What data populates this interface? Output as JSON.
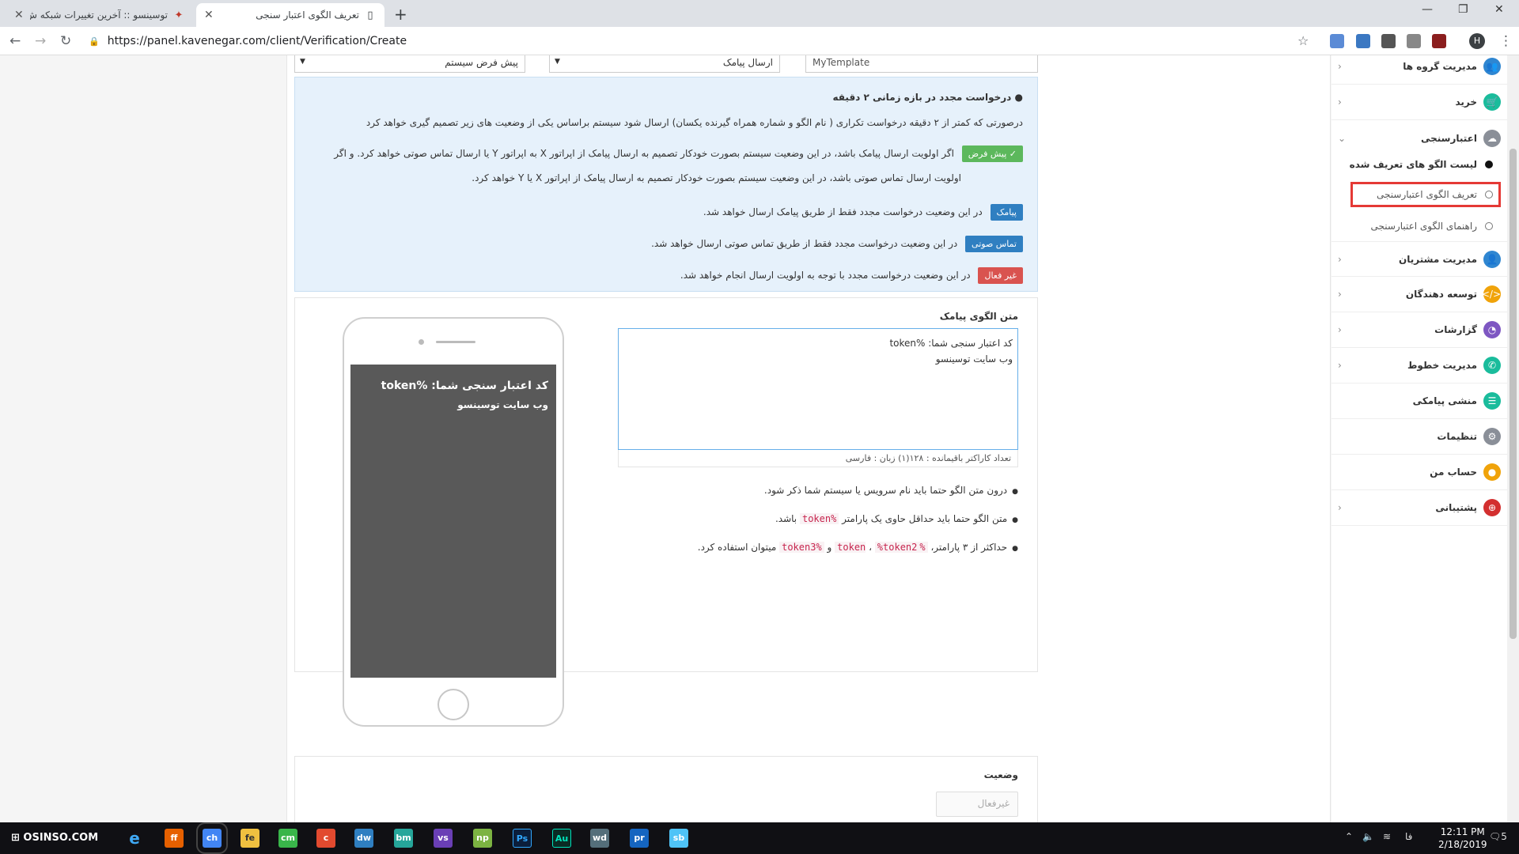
{
  "browser": {
    "tabs": [
      {
        "title": "توسینسو :: آخرین تغییرات شبکه ش..."
      },
      {
        "title": "تعریف الگوی اعتبار سنجی"
      }
    ],
    "url": "https://panel.kavenegar.com/client/Verification/Create",
    "profile_initial": "H",
    "new_tab": "+",
    "window_controls": {
      "minimize": "—",
      "restore": "❐",
      "close": "✕"
    },
    "nav": {
      "back": "←",
      "forward": "→",
      "reload": "↻",
      "star": "☆",
      "menu": "⋮"
    }
  },
  "top_row": {
    "template_name_value": "MyTemplate",
    "send_type_value": "ارسال پیامک",
    "default_value": "پیش فرض سیستم"
  },
  "info": {
    "title": "درخواست مجدد در بازه زمانی ۲ دقیقه",
    "intro": "درصورتی که کمتر از ۲ دقیقه درخواست تکراری ( نام الگو و شماره همراه گیرنده یکسان) ارسال شود سیستم براساس یکی از وضعیت های زیر تصمیم گیری خواهد کرد",
    "default_badge": "پیش فرض",
    "default_text_1": "اگر اولویت ارسال پیامک باشد، در این وضعیت سیستم بصورت خودکار تصمیم به ارسال پیامک از اپراتور X به اپراتور Y یا ارسال تماس صوتی خواهد کرد. و اگر",
    "default_text_2": "اولویت ارسال تماس صوتی باشد، در این وضعیت سیستم بصورت خودکار تصمیم به ارسال پیامک از اپراتور X یا Y خواهد کرد.",
    "sms_badge": "پیامک",
    "sms_text": "در این وضعیت درخواست مجدد فقط از طریق پیامک ارسال خواهد شد.",
    "voice_badge": "تماس صوتی",
    "voice_text": "در این وضعیت درخواست مجدد فقط از طریق تماس صوتی ارسال خواهد شد.",
    "disabled_badge": "غیر فعال",
    "disabled_text": "در این وضعیت درخواست مجدد با توجه به اولویت ارسال انجام خواهد شد."
  },
  "template": {
    "label": "متن الگوی پیامک",
    "text_value": "کد اعتبار سنجی شما: %token\nوب سایت توسینسو",
    "counter": "تعداد کاراکتر باقیمانده : ۱۲۸(۱)    زبان : فارسی",
    "rule1": "درون متن الگو حتما باید نام سرویس یا سیستم شما ذکر شود.",
    "rule2_pre": "متن الگو حتما باید حداقل حاوی یک پارامتر",
    "rule2_code": "%token",
    "rule2_post": "باشد.",
    "rule3_pre": "حداکثر از ۳ پارامتر،",
    "rule3_code1": "%token",
    "rule3_sep": "،",
    "rule3_code2": "%token2",
    "rule3_and": "و",
    "rule3_code3": "%token3",
    "rule3_post": "میتوان استفاده کرد."
  },
  "phone_preview": {
    "line1": "کد اعتبار سنجی شما: %token",
    "line2": "وب سایت توسینسو"
  },
  "status": {
    "label": "وضعیت",
    "value": "غیرفعال"
  },
  "sidebar": {
    "items": [
      {
        "label": "مدیریت گروه ها",
        "icon": "users-icon",
        "color": "#2f86d1",
        "chev": "‹"
      },
      {
        "label": "خرید",
        "icon": "cart-icon",
        "color": "#1abc9c",
        "chev": "‹"
      },
      {
        "label": "اعتبارسنجی",
        "icon": "cloud-icon",
        "color": "#8a8f98",
        "chev": "⌄"
      },
      {
        "label": "مدیریت مشتریان",
        "icon": "people-icon",
        "color": "#2f86d1",
        "chev": "‹"
      },
      {
        "label": "توسعه دهندگان",
        "icon": "code-icon",
        "color": "#f0a30a",
        "chev": "‹"
      },
      {
        "label": "گزارشات",
        "icon": "chart-icon",
        "color": "#7e57c2",
        "chev": "‹"
      },
      {
        "label": "مدیریت خطوط",
        "icon": "phone-icon",
        "color": "#1abc9c",
        "chev": "‹"
      },
      {
        "label": "منشی پیامکی",
        "icon": "inbox-icon",
        "color": "#1abc9c",
        "chev": ""
      },
      {
        "label": "تنظیمات",
        "icon": "gear-icon",
        "color": "#8a8f98",
        "chev": ""
      },
      {
        "label": "حساب من",
        "icon": "user-icon",
        "color": "#f0a30a",
        "chev": ""
      },
      {
        "label": "پشتیبانی",
        "icon": "support-icon",
        "color": "#d32f2f",
        "chev": "‹"
      }
    ],
    "sub_items": [
      {
        "label": "لیست الگو های تعریف شده"
      },
      {
        "label": "تعریف الگوی اعتبارسنجی"
      },
      {
        "label": "راهنمای الگوی اعتبارسنجی"
      }
    ]
  },
  "taskbar": {
    "start_label": "OSINSO.COM",
    "time": "12:11 PM",
    "date": "2/18/2019",
    "lang": "فا",
    "notifications": "5",
    "apps": [
      "e",
      "ff",
      "ch",
      "fe",
      "cm",
      "c",
      "dw",
      "bm",
      "vs",
      "np",
      "Ps",
      "Au",
      "wd",
      "pr",
      "sb"
    ]
  },
  "colors": {
    "info_bg": "#e6f1fb",
    "badge_green": "#5cb85c",
    "badge_blue": "#2f7fc1",
    "badge_red": "#d9534f",
    "highlight": "#e53935"
  }
}
